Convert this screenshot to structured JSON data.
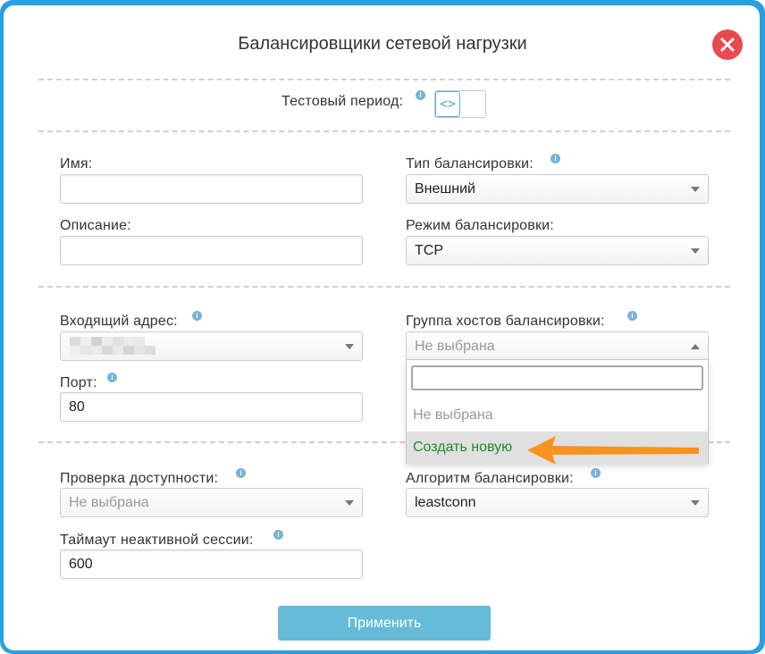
{
  "dialog": {
    "title": "Балансировщики сетевой нагрузки"
  },
  "test_period": {
    "label": "Тестовый период:",
    "toggle_symbol": "<>"
  },
  "fields": {
    "name": {
      "label": "Имя:",
      "value": ""
    },
    "description": {
      "label": "Описание:",
      "value": ""
    },
    "balancing_type": {
      "label": "Тип балансировки:",
      "value": "Внешний"
    },
    "balancing_mode": {
      "label": "Режим балансировки:",
      "value": "TCP"
    },
    "incoming_address": {
      "label": "Входящий адрес:"
    },
    "port": {
      "label": "Порт:",
      "value": "80"
    },
    "host_group": {
      "label": "Группа хостов балансировки:",
      "value": "Не выбрана",
      "search_value": "",
      "options": [
        "Не выбрана",
        "Создать новую"
      ]
    },
    "health_check": {
      "label": "Проверка доступности:",
      "value": "Не выбрана"
    },
    "algorithm": {
      "label": "Алгоритм балансировки:",
      "value": "leastconn"
    },
    "session_timeout": {
      "label": "Таймаут неактивной сессии:",
      "value": "600"
    }
  },
  "actions": {
    "apply_label": "Применить"
  },
  "colors": {
    "frame": "#2a9fe0",
    "close": "#e84a4f",
    "apply": "#66bbd8",
    "highlight_text": "#1d8a2a",
    "annotation_arrow": "#f7931e"
  },
  "icons": {
    "close": "close-icon",
    "info": "info-icon",
    "caret": "chevron-down-icon",
    "annotation": "arrow-left-icon"
  }
}
